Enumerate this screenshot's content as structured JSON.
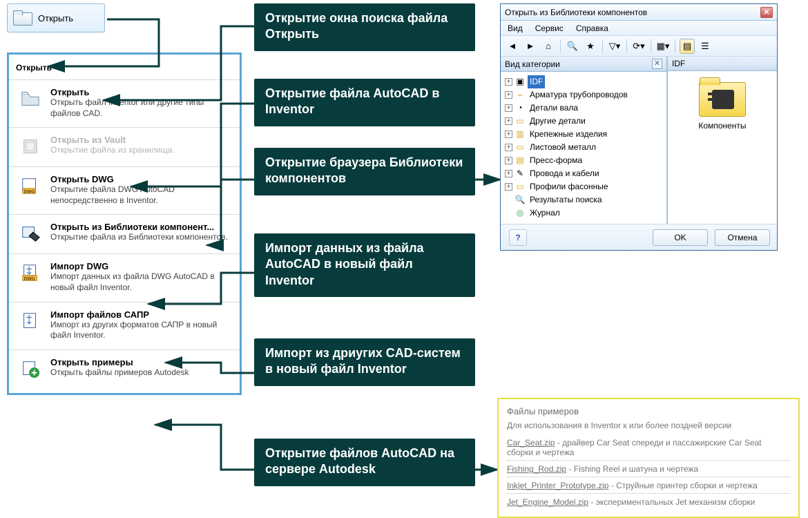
{
  "ribbon": {
    "open_label": "Открыть"
  },
  "menu": {
    "title": "Открыть",
    "items": [
      {
        "title": "Открыть",
        "desc": "Открыть файл Inventor или другие типы файлов CAD."
      },
      {
        "title": "Открыть из Vault",
        "desc": "Открытие файла из хранилища.",
        "disabled": true
      },
      {
        "title": "Открыть DWG",
        "desc": "Открытие файла DWG AutoCAD непосредственно в Inventor."
      },
      {
        "title": "Открыть из Библиотеки компонент...",
        "desc": "Открытие файла из Библиотеки компонентов."
      },
      {
        "title": "Импорт DWG",
        "desc": "Импорт данных из файла DWG AutoCAD в новый файл Inventor."
      },
      {
        "title": "Импорт файлов САПР",
        "desc": "Импорт из других форматов САПР в новый файл Inventor."
      },
      {
        "title": "Открыть примеры",
        "desc": "Открыть файлы примеров Autodesk"
      }
    ]
  },
  "callouts": [
    "Открытие окна поиска файла Открыть",
    "Открытие файла AutoCAD в Inventor",
    "Открытие браузера Библиотеки компонентов",
    "Импорт данных из файла  AutoCAD  в новый файл Inventor",
    "Импорт из дриугих CAD-систем  в новый файл Inventor",
    "Открытие файлов  AutoCAD  на сервере Autodesk"
  ],
  "lib": {
    "title": "Открыть из Библиотеки компонентов",
    "menus": [
      "Вид",
      "Сервис",
      "Справка"
    ],
    "tree_header": "Вид категории",
    "right_header": "IDF",
    "tree": [
      "IDF",
      "Арматура трубопроводов",
      "Детали вала",
      "Другие детали",
      "Крепежные изделия",
      "Листовой металл",
      "Пресс-форма",
      "Провода и кабели",
      "Профили фасонные",
      "Результаты поиска",
      "Журнал"
    ],
    "folder_label": "Компоненты",
    "ok": "OK",
    "cancel": "Отмена"
  },
  "samples": {
    "title": "Файлы примеров",
    "subtitle": "Для использования в Inventor к или более поздней версии",
    "items": [
      {
        "file": "Car_Seat.zip",
        "desc": "драйвер Car Seat спереди и пассажирские Car Seat сборки и чертежа"
      },
      {
        "file": "Fishing_Rod.zip",
        "desc": "Fishing Reel и шатуна и чертежа"
      },
      {
        "file": "Inkjet_Printer_Prototype.zip",
        "desc": "Струйные принтер сборки и чертежа"
      },
      {
        "file": "Jet_Engine_Model.zip",
        "desc": "экспериментальных Jet механизм сборки"
      }
    ]
  }
}
